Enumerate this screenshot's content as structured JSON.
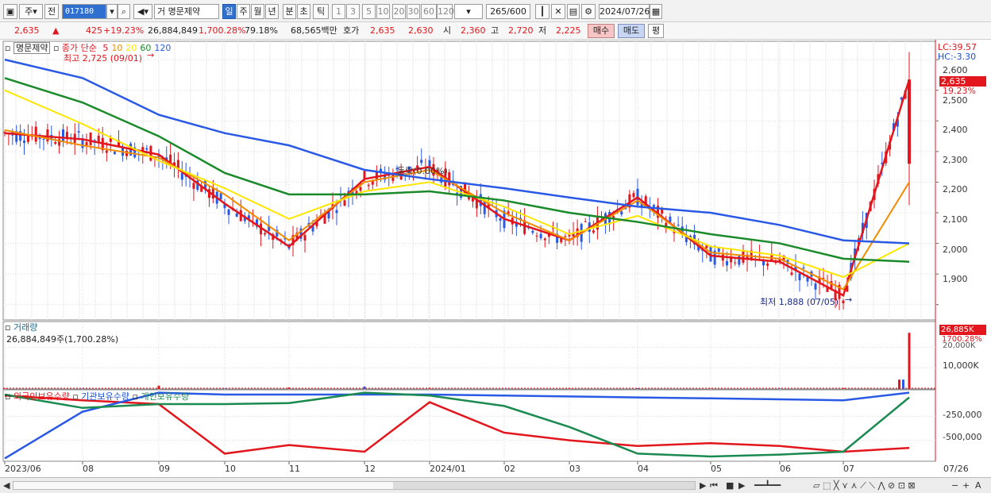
{
  "toolbar": {
    "period_main": "주",
    "prev_label": "전",
    "stock_code": "017180",
    "market_tag": "거",
    "stock_name": "명문제약",
    "period_tabs": [
      "일",
      "주",
      "월",
      "년",
      "분",
      "초",
      "틱"
    ],
    "active_period": "일",
    "interval_buttons": [
      "1",
      "3",
      "5",
      "10",
      "20",
      "30",
      "60",
      "120"
    ],
    "count_value": "265",
    "count_total": "/600",
    "date_value": "2024/07/26"
  },
  "infobar": {
    "price": "2,635",
    "change_arrow": "▲",
    "change": "425",
    "change_pct": "+19.23%",
    "volume": "26,884,849",
    "volume_ratio": "1,700.28%",
    "turnover": "79.18%",
    "amount": "68,565백만",
    "ask_label": "호가",
    "ask_value": "2,635",
    "bid_value": "2,630",
    "open_label": "시",
    "open_value": "2,360",
    "high_label": "고",
    "high_value": "2,720",
    "low_label": "저",
    "low_value": "2,225",
    "buy_label": "매수",
    "sell_label": "매도",
    "pyeong_label": "평"
  },
  "price_panel": {
    "stock_title": "명문제약",
    "ma_label": "종가 단순",
    "ma_periods": [
      "5",
      "10",
      "20",
      "60",
      "120"
    ],
    "ma_colors": [
      "#e2161c",
      "#f28c00",
      "#ffe600",
      "#1a8a2a",
      "#2a59e6"
    ],
    "high_marker": "최고 2,725 (09/01)",
    "low_marker": "최저 1,888 (07/05)",
    "mid_note": "등락(0.00%)",
    "lc_label": "LC:39.57",
    "hc_label": "HC:-3.30",
    "current_price_tag": "2,635",
    "current_pct_tag": "19.23%",
    "y_ticks": [
      "2,700",
      "2,600",
      "2,500",
      "2,400",
      "2,300",
      "2,200",
      "2,100",
      "2,000",
      "1,900"
    ]
  },
  "volume_panel": {
    "title": "거래량",
    "value_text": "26,884,849주(1,700.28%)",
    "current_tag": "26,885K",
    "pct_tag": "1700.28%",
    "y_ticks": [
      "20,000K",
      "10,000K"
    ]
  },
  "holding_panel": {
    "series_labels": [
      "외국인보유수량",
      "기관보유수량",
      "개인보유수량"
    ],
    "series_colors": [
      "#e2161c",
      "#2a59e6",
      "#1a8a50"
    ],
    "y_ticks": [
      "-250,000",
      "-500,000"
    ]
  },
  "x_axis": {
    "labels": [
      "2023/06",
      "08",
      "09",
      "10",
      "11",
      "12",
      "2024/01",
      "02",
      "03",
      "04",
      "05",
      "06",
      "07",
      "07/26"
    ]
  },
  "chart_data": [
    {
      "type": "line",
      "title": "명문제약",
      "x": [
        "2023/06",
        "08",
        "09",
        "10",
        "11",
        "12",
        "2024/01",
        "02",
        "03",
        "04",
        "05",
        "06",
        "07",
        "07/26"
      ],
      "ylim": [
        1850,
        2760
      ],
      "series": [
        {
          "name": "5",
          "values": [
            2460,
            2440,
            2390,
            2230,
            2090,
            2310,
            2350,
            2180,
            2110,
            2250,
            2060,
            2040,
            1930,
            2635
          ]
        },
        {
          "name": "10",
          "values": [
            2470,
            2420,
            2380,
            2260,
            2110,
            2300,
            2340,
            2200,
            2110,
            2240,
            2070,
            2050,
            1950,
            2300
          ]
        },
        {
          "name": "20",
          "values": [
            2600,
            2490,
            2370,
            2280,
            2180,
            2270,
            2300,
            2220,
            2130,
            2190,
            2090,
            2060,
            1990,
            2100
          ]
        },
        {
          "name": "60",
          "values": [
            2640,
            2560,
            2450,
            2330,
            2260,
            2260,
            2270,
            2240,
            2200,
            2170,
            2130,
            2100,
            2050,
            2040
          ]
        },
        {
          "name": "120",
          "values": [
            2700,
            2640,
            2520,
            2460,
            2420,
            2340,
            2310,
            2280,
            2250,
            2220,
            2200,
            2160,
            2110,
            2100
          ]
        }
      ]
    },
    {
      "type": "bar",
      "title": "거래량",
      "ylabel": "주",
      "categories": [
        "2023/06",
        "08",
        "09",
        "10",
        "11",
        "12",
        "2024/01",
        "02",
        "03",
        "04",
        "05",
        "06",
        "07",
        "07/26"
      ],
      "values": [
        300000,
        250000,
        1600000,
        300000,
        700000,
        1200000,
        600000,
        200000,
        300000,
        400000,
        200000,
        250000,
        500000,
        26884849
      ]
    },
    {
      "type": "line",
      "title": "보유수량",
      "x": [
        "2023/06",
        "08",
        "09",
        "10",
        "11",
        "12",
        "2024/01",
        "02",
        "03",
        "04",
        "05",
        "06",
        "07",
        "07/26"
      ],
      "series": [
        {
          "name": "외국인보유수량",
          "values": [
            -30000,
            -80000,
            -120000,
            -640000,
            -550000,
            -620000,
            -100000,
            -420000,
            -500000,
            -560000,
            -530000,
            -560000,
            -620000,
            -580000
          ]
        },
        {
          "name": "기관보유수량",
          "values": [
            -690000,
            -200000,
            0,
            -20000,
            -20000,
            -20000,
            -20000,
            -30000,
            -40000,
            -50000,
            -60000,
            -70000,
            -80000,
            0
          ]
        },
        {
          "name": "개인보유수량",
          "values": [
            -20000,
            -160000,
            -120000,
            -120000,
            -110000,
            0,
            -30000,
            -140000,
            -360000,
            -640000,
            -670000,
            -650000,
            -620000,
            -50000
          ]
        }
      ]
    }
  ]
}
